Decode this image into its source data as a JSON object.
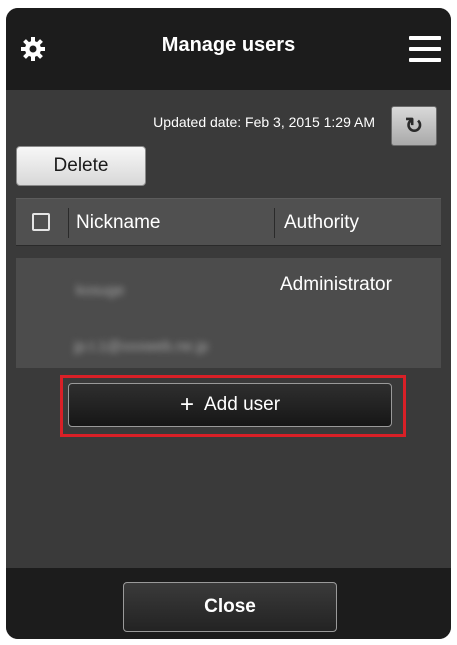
{
  "header": {
    "title": "Manage users",
    "settings_icon": "gear-icon",
    "menu_icon": "hamburger-menu-icon"
  },
  "toolbar": {
    "updated_text": "Updated date: Feb 3, 2015 1:29 AM",
    "refresh_icon": "refresh-icon",
    "refresh_glyph": "↻",
    "delete_label": "Delete"
  },
  "table": {
    "columns": [
      "Nickname",
      "Authority"
    ],
    "rows": [
      {
        "nickname": "kosuge",
        "email": "jp.t.1@xxxweb.ne.jp",
        "authority": "Administrator"
      }
    ]
  },
  "actions": {
    "add_user_label": "Add user",
    "add_icon": "plus-icon",
    "add_glyph": "+"
  },
  "footer": {
    "close_label": "Close"
  },
  "colors": {
    "background": "#3a3a3a",
    "bar": "#1c1c1c",
    "highlight": "#d92027"
  }
}
